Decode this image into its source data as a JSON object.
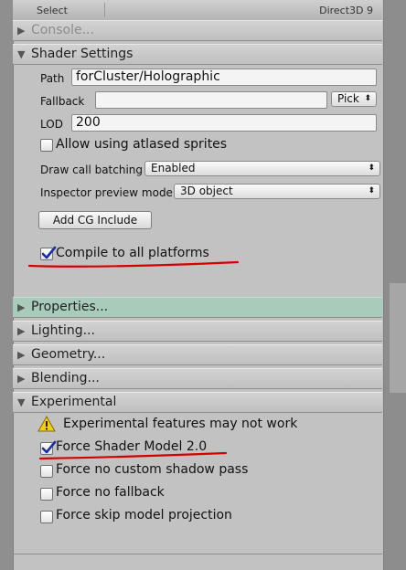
{
  "topbar": {
    "select_label": "Select",
    "renderer": "Direct3D 9"
  },
  "console": {
    "label": "Console..."
  },
  "shader_settings": {
    "title": "Shader Settings",
    "path_label": "Path",
    "path_value": "forCluster/Holographic",
    "fallback_label": "Fallback",
    "fallback_value": "",
    "pick_label": "Pick",
    "lod_label": "LOD",
    "lod_value": "200",
    "atlased_label": "Allow using atlased sprites",
    "atlased_checked": false,
    "batching_label": "Draw call batching",
    "batching_value": "Enabled",
    "preview_label": "Inspector preview mode",
    "preview_value": "3D object",
    "add_cg_label": "Add CG Include",
    "compile_label": "Compile to all platforms",
    "compile_checked": true
  },
  "sections": {
    "properties": "Properties...",
    "lighting": "Lighting...",
    "geometry": "Geometry...",
    "blending": "Blending..."
  },
  "experimental": {
    "title": "Experimental",
    "warning": "Experimental features may not work",
    "force_sm2_label": "Force Shader Model 2.0",
    "force_sm2_checked": true,
    "no_shadow_label": "Force no custom shadow pass",
    "no_shadow_checked": false,
    "no_fallback_label": "Force no fallback",
    "no_fallback_checked": false,
    "skip_projection_label": "Force skip model projection",
    "skip_projection_checked": false
  },
  "colors": {
    "panel_bg": "#c2c2c2",
    "highlight_section": "#a9cbbb",
    "annotation_red": "#d40000",
    "checkmark_blue": "#1c2f9a",
    "warning_yellow": "#f4cc1c"
  }
}
